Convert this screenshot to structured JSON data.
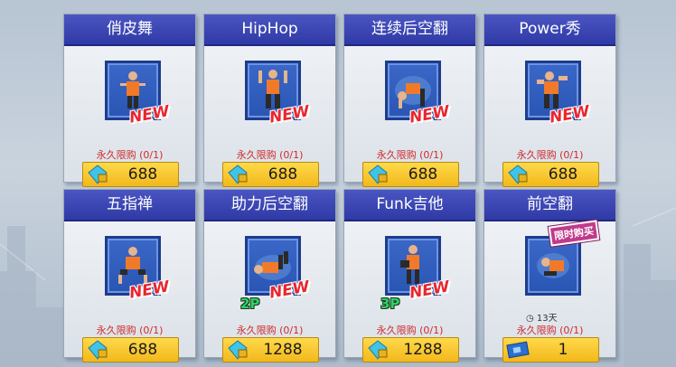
{
  "items": [
    {
      "name": "俏皮舞",
      "limit": "永久限购 (0/1)",
      "price": "688",
      "badge": "NEW",
      "players": ""
    },
    {
      "name": "HipHop",
      "limit": "永久限购 (0/1)",
      "price": "688",
      "badge": "NEW",
      "players": ""
    },
    {
      "name": "连续后空翻",
      "limit": "永久限购 (0/1)",
      "price": "688",
      "badge": "NEW",
      "players": ""
    },
    {
      "name": "Power秀",
      "limit": "永久限购 (0/1)",
      "price": "688",
      "badge": "NEW",
      "players": ""
    },
    {
      "name": "五指禅",
      "limit": "永久限购 (0/1)",
      "price": "688",
      "badge": "NEW",
      "players": ""
    },
    {
      "name": "助力后空翻",
      "limit": "永久限购 (0/1)",
      "price": "1288",
      "badge": "NEW",
      "players": "2P"
    },
    {
      "name": "Funk吉他",
      "limit": "永久限购 (0/1)",
      "price": "1288",
      "badge": "NEW",
      "players": "3P"
    },
    {
      "name": "前空翻",
      "limit": "永久限购 (0/1)",
      "price": "1",
      "badge": "",
      "players": "",
      "limited_tag": "限时购买",
      "timer": "13天"
    }
  ],
  "colors": {
    "title_bar": "#3a45b6",
    "price_bg": "#f7c62e",
    "new_text": "#e8262e",
    "limit_text": "#cf2a2a"
  }
}
